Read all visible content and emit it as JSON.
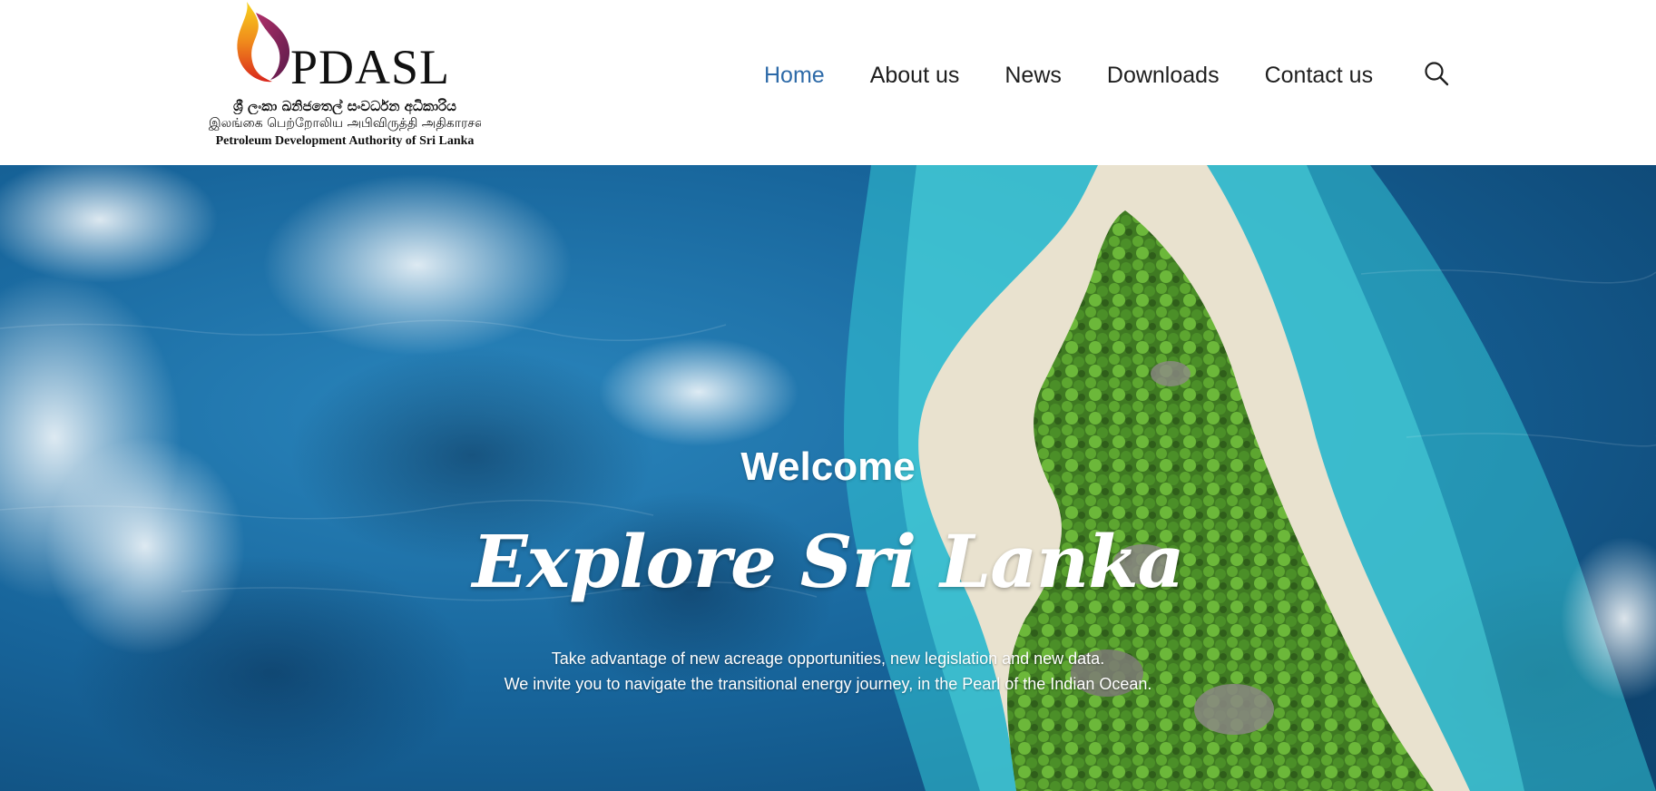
{
  "logo": {
    "wordmark": "PDASL",
    "line_sinhala": "ශ්‍රී ලංකා ඛනිජතෙල් සංවර්ධන අධිකාරිය",
    "line_tamil": "இலங்கை பெற்றோலிய அபிவிருத்தி அதிகாரசபை",
    "line_english": "Petroleum Development Authority of Sri Lanka"
  },
  "nav": {
    "items": [
      {
        "label": "Home",
        "active": true
      },
      {
        "label": "About us"
      },
      {
        "label": "News"
      },
      {
        "label": "Downloads"
      },
      {
        "label": "Contact us"
      }
    ],
    "search_icon": "search-icon",
    "active_color": "#2d6aa8"
  },
  "hero": {
    "welcome": "Welcome",
    "title": "Explore Sri Lanka",
    "text_line1": "Take advantage of new acreage opportunities, new legislation and new data.",
    "text_line2": "We invite you to navigate the transitional energy journey, in the Pearl of the Indian Ocean."
  }
}
